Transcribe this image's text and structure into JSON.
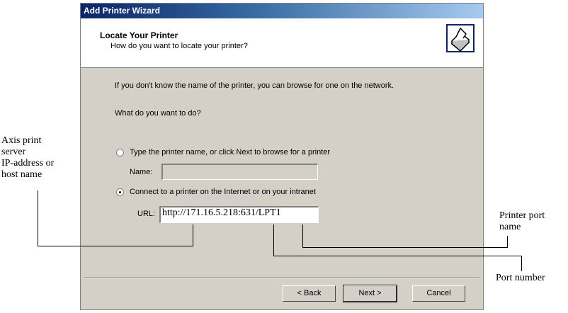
{
  "window": {
    "title": "Add Printer Wizard",
    "header_title": "Locate Your Printer",
    "header_subtitle": "How do you want to locate your printer?"
  },
  "body": {
    "intro": "If you don't know the name of the printer, you can browse for one on the network.",
    "question": "What do you want to do?",
    "option_browse": "Type the printer name, or click Next to browse for a printer",
    "name_label": "Name:",
    "name_value": "",
    "option_url": "Connect to a printer on the Internet or on your intranet",
    "url_label": "URL:",
    "url_value": "http://171.16.5.218:631/LPT1",
    "selected_option": "connect-url"
  },
  "buttons": {
    "back": "< Back",
    "next": "Next >",
    "cancel": "Cancel"
  },
  "annotations": {
    "axis_line1": "Axis print",
    "axis_line2": "server",
    "axis_line3": "IP-address or",
    "axis_line4": "host name",
    "port_name_line1": "Printer port",
    "port_name_line2": "name",
    "port_number": "Port number"
  },
  "icons": {
    "header": "printer-icon"
  }
}
